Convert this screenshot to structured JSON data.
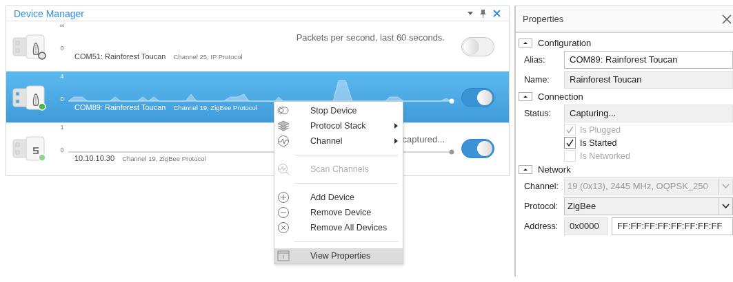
{
  "device_manager": {
    "title": "Device Manager",
    "devices": [
      {
        "kind": "probe",
        "color": "#e4e4e4",
        "axis_max": "∞",
        "axis_min": "0",
        "name": "COM51: Rainforest Toucan",
        "detail": "Channel 25, IP Protocol",
        "message": "Packets per second, last 60 seconds.",
        "on": false,
        "selected": false
      },
      {
        "kind": "probe",
        "color": "#4cb847",
        "axis_max": "4",
        "axis_min": "0",
        "name": "COM89: Rainforest Toucan",
        "detail": "Channel 19, ZigBee Protocol",
        "on": true,
        "selected": true
      },
      {
        "kind": "cable",
        "color": "#8ed68a",
        "axis_max": "1",
        "axis_min": "0",
        "name": "10.10.10.30",
        "detail": "Channel 19, ZigBee Protocol",
        "message": "captured...",
        "on": true,
        "selected": false
      }
    ]
  },
  "context_menu": {
    "items": [
      {
        "kind": "item",
        "label": "Stop Device",
        "submenu": false,
        "disabled": false,
        "selected": false
      },
      {
        "kind": "item",
        "label": "Protocol Stack",
        "submenu": true,
        "disabled": false,
        "selected": false
      },
      {
        "kind": "item",
        "label": "Channel",
        "submenu": true,
        "disabled": false,
        "selected": false
      },
      {
        "kind": "separator"
      },
      {
        "kind": "item",
        "label": "Scan Channels",
        "submenu": false,
        "disabled": true,
        "selected": false
      },
      {
        "kind": "separator"
      },
      {
        "kind": "item",
        "label": "Add Device",
        "submenu": false,
        "disabled": false,
        "selected": false
      },
      {
        "kind": "item",
        "label": "Remove Device",
        "submenu": false,
        "disabled": false,
        "selected": false
      },
      {
        "kind": "item",
        "label": "Remove All Devices",
        "submenu": false,
        "disabled": false,
        "selected": false
      },
      {
        "kind": "separator"
      },
      {
        "kind": "item",
        "label": "View Properties",
        "submenu": false,
        "disabled": false,
        "selected": true
      }
    ]
  },
  "properties": {
    "title": "Properties",
    "sections": [
      {
        "title": "Configuration",
        "expanded": true,
        "fields": [
          {
            "kind": "text",
            "label": "Alias:",
            "value": "COM89: Rainforest Toucan",
            "readonly": false
          },
          {
            "kind": "text",
            "label": "Name:",
            "value": "Rainforest Toucan",
            "readonly": true
          }
        ]
      },
      {
        "title": "Connection",
        "expanded": true,
        "fields": [
          {
            "kind": "text",
            "label": "Status:",
            "value": "Capturing...",
            "readonly": true
          },
          {
            "kind": "checkbox",
            "label": "Is Plugged",
            "checked": true,
            "disabled": true
          },
          {
            "kind": "checkbox",
            "label": "Is Started",
            "checked": true,
            "disabled": false
          },
          {
            "kind": "checkbox",
            "label": "Is Networked",
            "checked": false,
            "disabled": true
          }
        ]
      },
      {
        "title": "Network",
        "expanded": true,
        "fields": [
          {
            "kind": "dropdown",
            "label": "Channel:",
            "value": "19 (0x13), 2445 MHz, OQPSK_250",
            "disabled": true
          },
          {
            "kind": "dropdown",
            "label": "Protocol:",
            "value": "ZigBee",
            "disabled": false
          },
          {
            "kind": "pair",
            "label": "Address:",
            "short": "0x0000",
            "long": "FF:FF:FF:FF:FF:FF:FF:FF"
          }
        ]
      }
    ]
  }
}
